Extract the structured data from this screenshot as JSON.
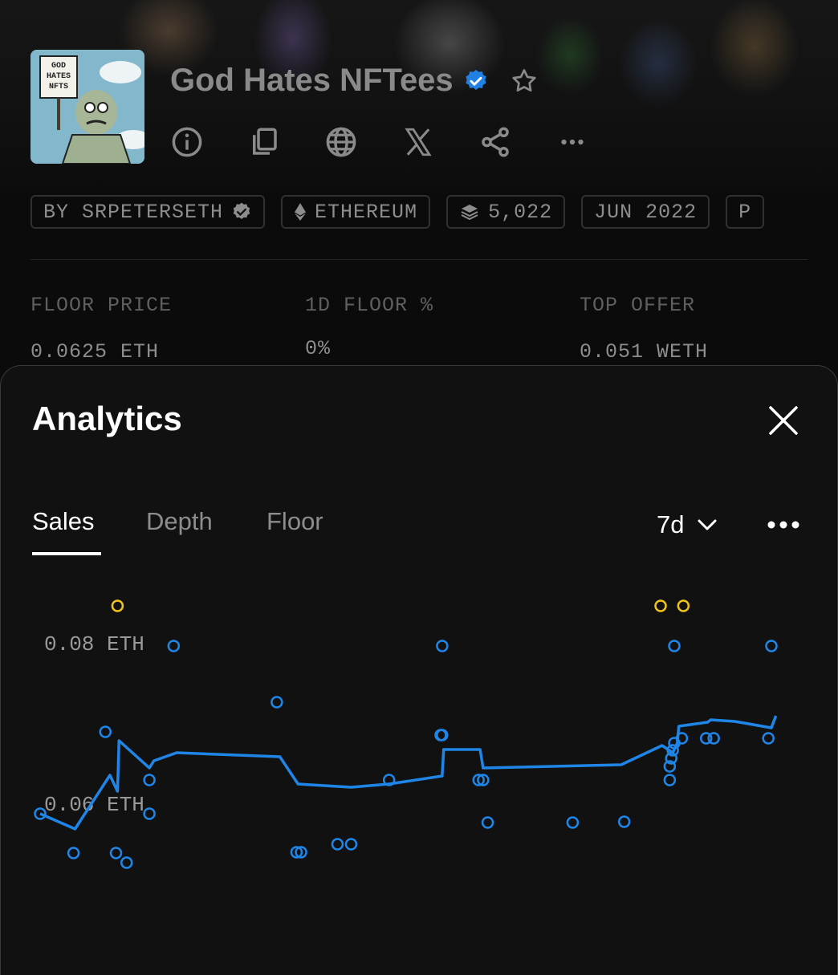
{
  "collection": {
    "name": "God Hates NFTees",
    "avatar_sign_text": "GOD HATES NFTS"
  },
  "header_icons": [
    "info-icon",
    "copy-icon",
    "globe-icon",
    "x-icon",
    "share-icon",
    "more-icon"
  ],
  "tags": [
    {
      "label": "BY SRPETERSETH",
      "icon": "verified-icon"
    },
    {
      "label": "ETHEREUM",
      "icon": "ethereum-icon"
    },
    {
      "label": "5,022",
      "icon": "layers-icon"
    },
    {
      "label": "JUN 2022",
      "icon": ""
    },
    {
      "label": "P",
      "icon": ""
    }
  ],
  "stats": [
    {
      "label": "FLOOR PRICE",
      "value": "0.0625 ETH"
    },
    {
      "label": "1D FLOOR %",
      "value": "0%"
    },
    {
      "label": "TOP OFFER",
      "value": "0.051 WETH"
    }
  ],
  "analytics": {
    "title": "Analytics",
    "tabs": [
      "Sales",
      "Depth",
      "Floor"
    ],
    "active_tab": "Sales",
    "range": "7d"
  },
  "colors": {
    "accent_blue": "#1f86e8",
    "highlight_yellow": "#f0c419",
    "verified_blue": "#2081e2"
  },
  "chart_data": {
    "type": "scatter",
    "x_unit": "index over 7d window",
    "xlim": [
      0,
      1000
    ],
    "ylim": [
      0.04,
      0.09
    ],
    "y_ticks": [
      {
        "value": 0.08,
        "label": "0.08 ETH"
      },
      {
        "value": 0.06,
        "label": "0.06 ETH"
      }
    ],
    "series": [
      {
        "style": "points-blue",
        "points": [
          [
            0,
            0.0586
          ],
          [
            44,
            0.0537
          ],
          [
            86,
            0.0688
          ],
          [
            100,
            0.0537
          ],
          [
            114,
            0.0525
          ],
          [
            144,
            0.0628
          ],
          [
            144,
            0.0586
          ],
          [
            176,
            0.0795
          ],
          [
            312,
            0.0725
          ],
          [
            338,
            0.0538
          ],
          [
            344,
            0.0538
          ],
          [
            392,
            0.0548
          ],
          [
            410,
            0.0548
          ],
          [
            460,
            0.0628
          ],
          [
            528,
            0.0684
          ],
          [
            530,
            0.0684
          ],
          [
            530,
            0.0795
          ],
          [
            578,
            0.0628
          ],
          [
            584,
            0.0628
          ],
          [
            590,
            0.0575
          ],
          [
            702,
            0.0575
          ],
          [
            770,
            0.0576
          ],
          [
            830,
            0.0628
          ],
          [
            830,
            0.0645
          ],
          [
            832,
            0.0655
          ],
          [
            834,
            0.0665
          ],
          [
            836,
            0.0674
          ],
          [
            846,
            0.068
          ],
          [
            836,
            0.0795
          ],
          [
            878,
            0.068
          ],
          [
            888,
            0.068
          ],
          [
            960,
            0.068
          ],
          [
            964,
            0.0795
          ]
        ]
      },
      {
        "style": "points-yellow",
        "points": [
          [
            102,
            0.0845
          ],
          [
            818,
            0.0845
          ],
          [
            848,
            0.0845
          ]
        ]
      },
      {
        "style": "line-blue",
        "points": [
          [
            0,
            0.0586
          ],
          [
            46,
            0.0567
          ],
          [
            92,
            0.0634
          ],
          [
            102,
            0.0614
          ],
          [
            104,
            0.0677
          ],
          [
            144,
            0.0643
          ],
          [
            150,
            0.0652
          ],
          [
            180,
            0.0662
          ],
          [
            316,
            0.0657
          ],
          [
            340,
            0.0623
          ],
          [
            410,
            0.0619
          ],
          [
            460,
            0.0623
          ],
          [
            530,
            0.0633
          ],
          [
            532,
            0.0666
          ],
          [
            580,
            0.0666
          ],
          [
            584,
            0.0643
          ],
          [
            766,
            0.0647
          ],
          [
            820,
            0.0671
          ],
          [
            834,
            0.0662
          ],
          [
            840,
            0.0674
          ],
          [
            842,
            0.0695
          ],
          [
            880,
            0.07
          ],
          [
            884,
            0.0703
          ],
          [
            916,
            0.0701
          ],
          [
            964,
            0.0693
          ],
          [
            970,
            0.0708
          ]
        ]
      }
    ]
  }
}
